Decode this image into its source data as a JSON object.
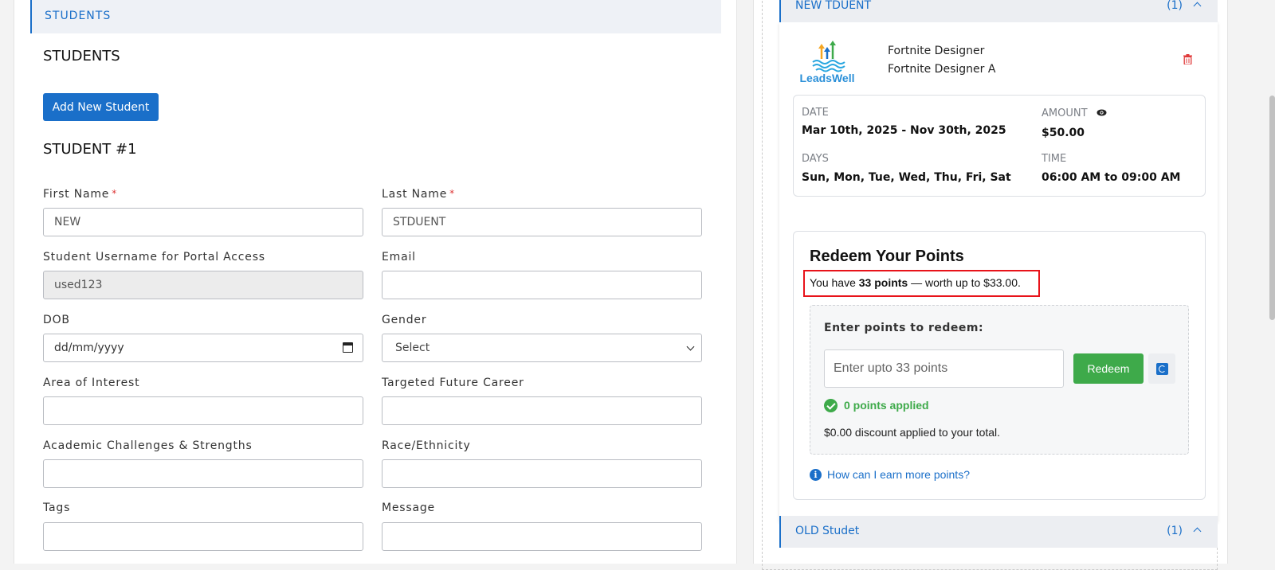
{
  "left": {
    "section_header": "STUDENTS",
    "page_title": "STUDENTS",
    "add_button": "Add New Student",
    "student_title": "STUDENT #1",
    "fields": {
      "first_name": {
        "label": "First Name",
        "required": "*",
        "value": "NEW"
      },
      "last_name": {
        "label": "Last Name",
        "required": "*",
        "value": "STDUENT"
      },
      "username": {
        "label": "Student Username for Portal Access",
        "value": "used123"
      },
      "email": {
        "label": "Email",
        "value": ""
      },
      "dob": {
        "label": "DOB",
        "placeholder": "dd/mm/yyyy"
      },
      "gender": {
        "label": "Gender",
        "value": "Select"
      },
      "area_of_interest": {
        "label": "Area of Interest",
        "value": ""
      },
      "targeted_career": {
        "label": "Targeted Future Career",
        "value": ""
      },
      "academic": {
        "label": "Academic Challenges & Strengths",
        "value": ""
      },
      "race": {
        "label": "Race/Ethnicity",
        "value": ""
      },
      "tags": {
        "label": "Tags",
        "value": ""
      },
      "message": {
        "label": "Message",
        "value": ""
      }
    }
  },
  "right": {
    "accordion_new": {
      "title": "NEW TDUENT",
      "count": "(1)"
    },
    "accordion_old": {
      "title": "OLD Studet",
      "count": "(1)"
    },
    "course": {
      "logo_text": "LeadsWell",
      "name_1": "Fortnite Designer",
      "name_2": "Fortnite Designer A",
      "date_label": "DATE",
      "date_value": "Mar 10th, 2025 - Nov 30th, 2025",
      "amount_label": "AMOUNT",
      "amount_value": "$50.00",
      "days_label": "DAYS",
      "days_value": "Sun, Mon, Tue, Wed, Thu, Fri, Sat",
      "time_label": "TIME",
      "time_value": "06:00 AM to 09:00 AM"
    },
    "redeem": {
      "title": "Redeem Your Points",
      "points_prefix": "You have ",
      "points_bold": "33 points",
      "points_suffix": " — worth up to $33.00.",
      "enter_label": "Enter points to redeem:",
      "input_placeholder": "Enter upto 33 points",
      "redeem_button": "Redeem",
      "applied_text": "0 points applied",
      "discount_text": "$0.00 discount applied to your total.",
      "earn_link": "How can I earn more points?"
    }
  },
  "colors": {
    "primary": "#1a6fc9",
    "success": "#3eaa4a",
    "danger": "#e8131a"
  }
}
